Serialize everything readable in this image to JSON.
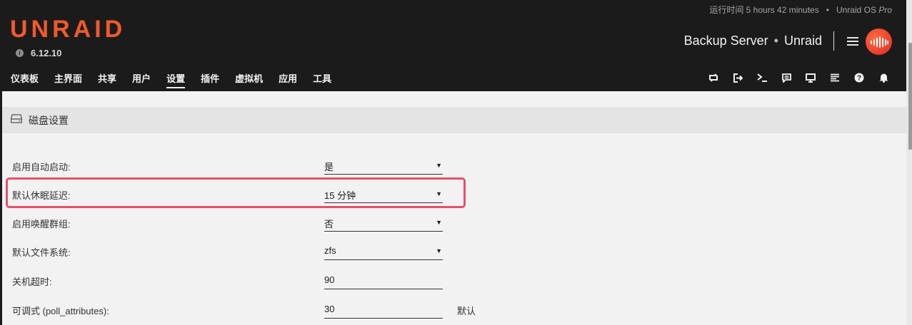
{
  "header": {
    "uptime_label": "运行时间 5 hours 42 minutes",
    "edition_prefix": "Unraid OS",
    "edition_suffix": "Pro",
    "logo_text": "UNRAID",
    "version": "6.12.10",
    "server_name": "Backup Server",
    "server_os": "Unraid",
    "nav": [
      "仪表板",
      "主界面",
      "共享",
      "用户",
      "设置",
      "插件",
      "虚拟机",
      "应用",
      "工具"
    ],
    "active_nav": "设置",
    "toolbar_icons": [
      "switch-icon",
      "logout-icon",
      "terminal-icon",
      "feedback-icon",
      "monitor-icon",
      "log-icon",
      "help-icon",
      "bell-icon"
    ]
  },
  "panel": {
    "title": "磁盘设置",
    "icon": "hard-drive-icon"
  },
  "settings": [
    {
      "label": "启用自动启动:",
      "value": "是",
      "type": "select"
    },
    {
      "label": "默认休眠延迟:",
      "value": "15 分钟",
      "type": "select"
    },
    {
      "label": "启用唤醒群组:",
      "value": "否",
      "type": "select"
    },
    {
      "label": "默认文件系统:",
      "value": "zfs",
      "type": "select"
    },
    {
      "label": "关机超时:",
      "value": "90",
      "type": "input"
    },
    {
      "label": "可调式 (poll_attributes):",
      "value": "30",
      "type": "input",
      "extra": "默认"
    }
  ],
  "colors": {
    "header_bg": "#1c1b1b",
    "brand_orange": "#f15a2c",
    "highlight": "#e8506a"
  }
}
